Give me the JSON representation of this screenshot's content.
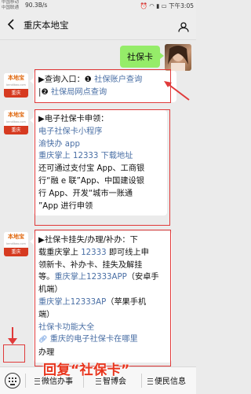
{
  "status_bar": {
    "carrier_1": "中国移动",
    "carrier_2": "中国联通",
    "speed": "90.3B/s",
    "time": "下午3:05"
  },
  "header": {
    "back_icon": "chevron-left-icon",
    "title": "重庆本地宝",
    "person_icon": "person-icon"
  },
  "avatars": {
    "bot_logo_text": "本地宝",
    "bot_logo_sub": "bendibao.com",
    "bot_city": "重庆"
  },
  "messages": {
    "user_message": "社保卡",
    "msg1": {
      "line1_prefix": "▶查询入口：",
      "line1_num": "❶",
      "line1_link": "社保账户查询",
      "line2_prefix": "|",
      "line2_num": "❷",
      "line2_link": "社保局网点查询"
    },
    "msg2": {
      "heading": "▶电子社保卡申领：",
      "link1": "电子社保卡小程序",
      "link2": "渝快办 app",
      "link3": "重庆掌上 12333 下载地址",
      "text1": "还可通过支付宝 App、工商银",
      "text2": "行“融 e 联”App、中国建设银",
      "text3": "行 App、开发“城市一账通",
      "text4": "”App 进行申领"
    },
    "msg3": {
      "line1": "▶社保卡挂失/办理/补办：下",
      "line2_a": "载重庆掌上 ",
      "line2_link": "12333",
      "line2_b": " 即可线上申",
      "line3": "领新卡、补办卡、挂失及解挂",
      "line4_a": "等。",
      "line4_link": "重庆掌上12333APP",
      "line4_b": "（安卓手",
      "line5": "机端）",
      "line6_link": "重庆掌上12333AP",
      "line6_b": "（苹果手机",
      "line7": "端）",
      "line8_link": "社保卡功能大全",
      "line9_icon": "link-icon",
      "line9_link": "重庆的电子社保卡在哪里",
      "line10": "办理"
    }
  },
  "bottom_bar": {
    "keyboard_icon": "keyboard-icon",
    "menu1": "微信办事",
    "menu2": "智博会",
    "menu3": "便民信息"
  },
  "overlay": {
    "promo_text": "回复“社保卡”"
  },
  "colors": {
    "link": "#4a6fa5",
    "highlight_red": "#e03a3a",
    "user_bubble": "#95ec69",
    "promo": "#e8341c"
  }
}
